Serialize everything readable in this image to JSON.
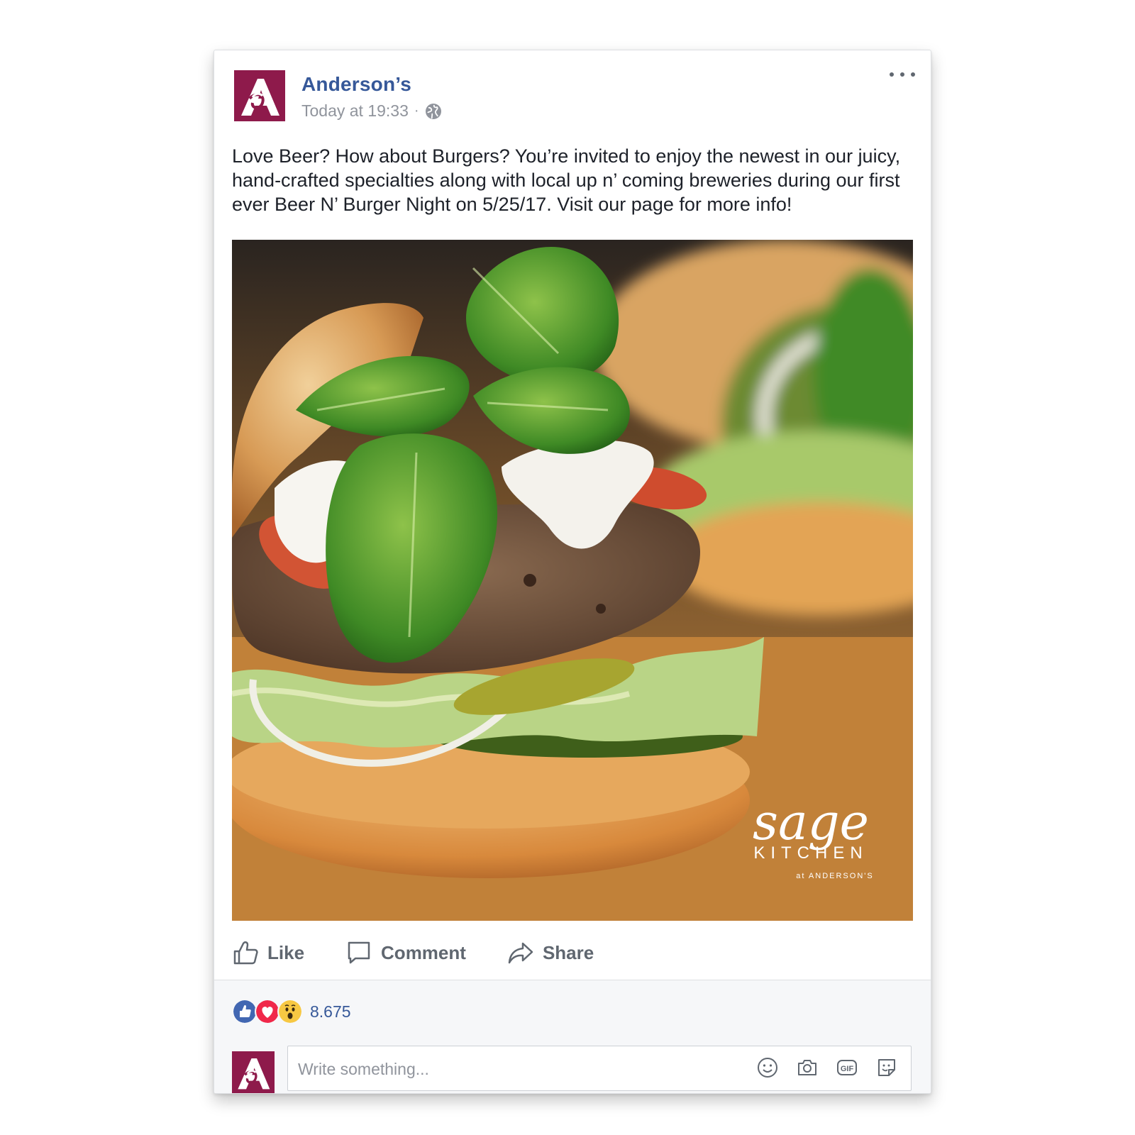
{
  "post": {
    "page_name": "Anderson’s",
    "timestamp": "Today at 19:33",
    "separator": "·",
    "audience_icon": "globe-icon",
    "text": "Love Beer? How about Burgers? You’re invited to enjoy the newest in our juicy, hand-crafted specialties along with local up n’ coming breweries during our first ever Beer N’ Burger Night on 5/25/17. Visit our page for more info!",
    "image": {
      "watermark_script": "sage",
      "watermark_word": "KITCHEN",
      "watermark_sub": "at ANDERSON'S"
    }
  },
  "actions": {
    "like": "Like",
    "comment": "Comment",
    "share": "Share"
  },
  "reactions": {
    "types": [
      "like",
      "love",
      "wow"
    ],
    "count": "8.675"
  },
  "composer": {
    "placeholder": "Write something...",
    "icons": [
      "emoji-icon",
      "camera-icon",
      "gif-icon",
      "sticker-icon"
    ]
  },
  "colors": {
    "brand": "#8e1a4b",
    "link": "#365899",
    "like_blue": "#4267b2",
    "love_red": "#f0284a",
    "wow_yellow": "#f7c843"
  }
}
